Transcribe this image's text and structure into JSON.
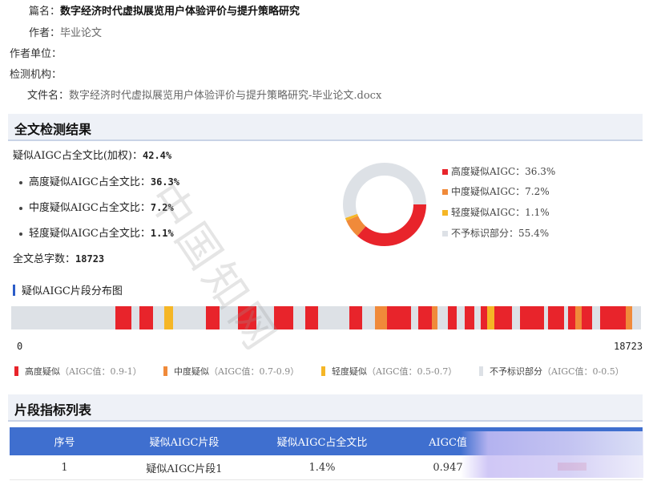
{
  "meta": {
    "title_label": "篇名：",
    "title_value": "数字经济时代虚拟展览用户体验评价与提升策略研究",
    "author_label": "作者：",
    "author_value": "毕业论文",
    "affiliation_label": "作者单位：",
    "institution_label": "检测机构：",
    "file_label": "文件名：",
    "file_value": "数字经济时代虚拟展览用户体验评价与提升策略研究-毕业论文.docx"
  },
  "result": {
    "section_title": "全文检测结果",
    "overall_label": "疑似AIGC占全文比(加权)：",
    "overall_value": "42.4%",
    "high_label": "高度疑似AIGC占全文比：",
    "high_value": "36.3%",
    "mid_label": "中度疑似AIGC占全文比：",
    "mid_value": "7.2%",
    "low_label": "轻度疑似AIGC占全文比：",
    "low_value": "1.1%",
    "chars_label": "全文总字数：",
    "chars_value": "18723"
  },
  "chart_data": {
    "type": "pie",
    "variant": "donut",
    "categories": [
      "高度疑似AIGC",
      "中度疑似AIGC",
      "轻度疑似AIGC",
      "不予标识部分"
    ],
    "values": [
      36.3,
      7.2,
      1.1,
      55.4
    ],
    "legend_labels": [
      "高度疑似AIGC：36.3%",
      "中度疑似AIGC：7.2%",
      "轻度疑似AIGC：1.1%",
      "不予标识部分：55.4%"
    ],
    "colors": [
      "#e8242b",
      "#f08a3a",
      "#f5b626",
      "#dde1e6"
    ],
    "legend_position": "right"
  },
  "distribution": {
    "title": "疑似AIGC片段分布图",
    "start_label": "0",
    "end_label": "18723",
    "total": 18723,
    "colors": {
      "high": "#e8242b",
      "mid": "#f08a3a",
      "low": "#f5b626",
      "none": "#dde1e6"
    },
    "segments": [
      {
        "level": "high",
        "start": 3093,
        "end": 3570
      },
      {
        "level": "high",
        "start": 3808,
        "end": 4213
      },
      {
        "level": "low",
        "start": 4547,
        "end": 4808
      },
      {
        "level": "high",
        "start": 5785,
        "end": 6190
      },
      {
        "level": "high",
        "start": 6738,
        "end": 7286
      },
      {
        "level": "high",
        "start": 7810,
        "end": 8381
      },
      {
        "level": "high",
        "start": 8738,
        "end": 9119
      },
      {
        "level": "high",
        "start": 10048,
        "end": 10429
      },
      {
        "level": "mid",
        "start": 10810,
        "end": 11167
      },
      {
        "level": "high",
        "start": 11167,
        "end": 11881
      },
      {
        "level": "high",
        "start": 12095,
        "end": 12500
      },
      {
        "level": "mid",
        "start": 12500,
        "end": 12666
      },
      {
        "level": "high",
        "start": 12976,
        "end": 13238
      },
      {
        "level": "high",
        "start": 13476,
        "end": 13762
      },
      {
        "level": "high",
        "start": 13952,
        "end": 14143
      },
      {
        "level": "low",
        "start": 14143,
        "end": 14357
      },
      {
        "level": "high",
        "start": 14357,
        "end": 14881
      },
      {
        "level": "high",
        "start": 15119,
        "end": 15833
      },
      {
        "level": "high",
        "start": 15952,
        "end": 16429
      },
      {
        "level": "high",
        "start": 16548,
        "end": 16762
      },
      {
        "level": "mid",
        "start": 16762,
        "end": 16952
      },
      {
        "level": "high",
        "start": 16952,
        "end": 17262
      },
      {
        "level": "high",
        "start": 17500,
        "end": 18261
      },
      {
        "level": "mid",
        "start": 18261,
        "end": 18452
      }
    ]
  },
  "legend_keys": [
    {
      "name": "高度疑似",
      "range": "（AIGC值：0.9-1）",
      "color": "#e8242b"
    },
    {
      "name": "中度疑似",
      "range": "（AIGC值：0.7-0.9）",
      "color": "#f08a3a"
    },
    {
      "name": "轻度疑似",
      "range": "（AIGC值：0.5-0.7）",
      "color": "#f5b626"
    },
    {
      "name": "不予标识部分",
      "range": "（AIGC值：0-0.5）",
      "color": "#dde1e6"
    }
  ],
  "segment_table": {
    "section_title": "片段指标列表",
    "headers": [
      "序号",
      "疑似AIGC片段",
      "疑似AIGC占全文比",
      "AIGC值",
      ""
    ],
    "rows": [
      {
        "index": "1",
        "name": "疑似AIGC片段1",
        "ratio": "1.4%",
        "value": "0.947",
        "level": "high"
      }
    ]
  },
  "watermark": "中国知网"
}
